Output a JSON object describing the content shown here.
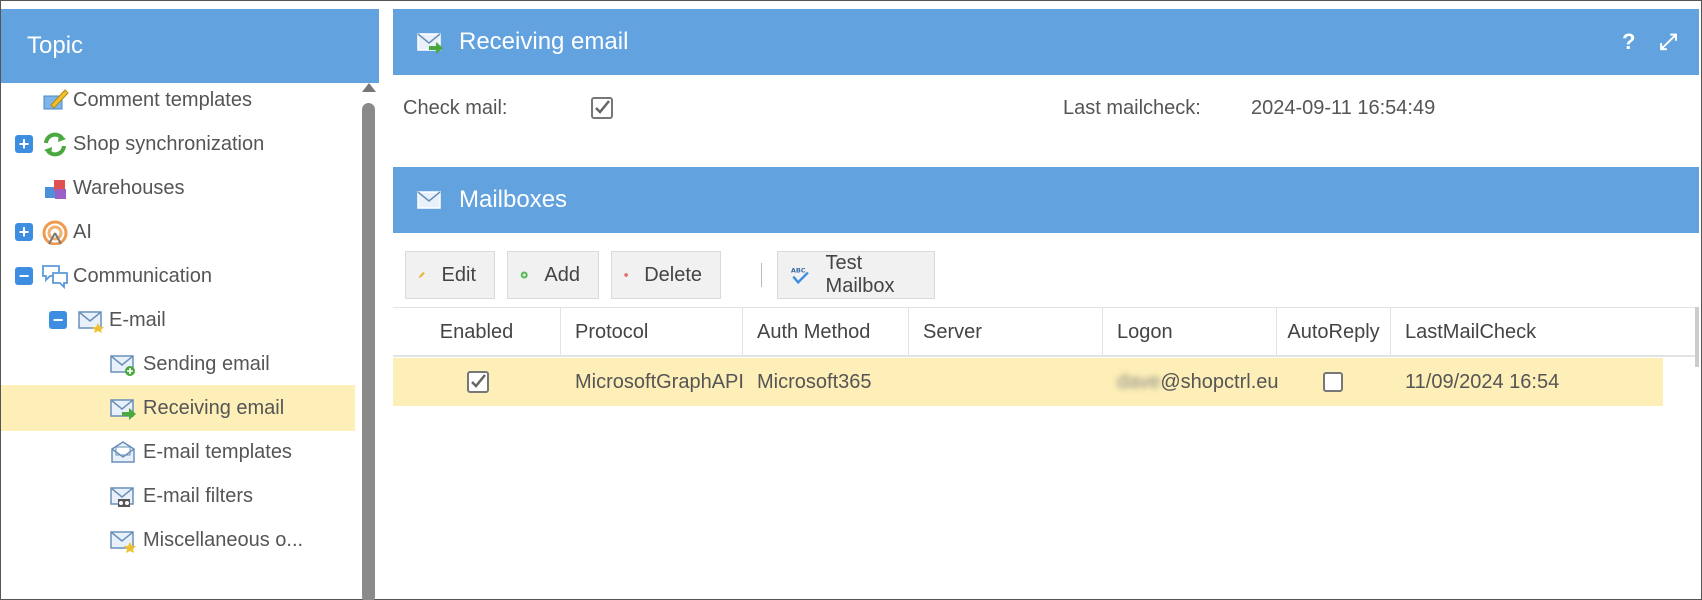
{
  "left_panel": {
    "title": "Topic",
    "items": [
      {
        "label": "Comment templates",
        "icon": "comment-template-icon",
        "expander": ""
      },
      {
        "label": "Shop synchronization",
        "icon": "sync-icon",
        "expander": "+"
      },
      {
        "label": "Warehouses",
        "icon": "warehouse-icon",
        "expander": ""
      },
      {
        "label": "AI",
        "icon": "ai-icon",
        "expander": "+"
      },
      {
        "label": "Communication",
        "icon": "communication-icon",
        "expander": "−"
      },
      {
        "label": "E-mail",
        "icon": "email-folder-icon",
        "expander": "−"
      },
      {
        "label": "Sending email",
        "icon": "send-email-icon",
        "expander": ""
      },
      {
        "label": "Receiving email",
        "icon": "receive-email-icon",
        "expander": ""
      },
      {
        "label": "E-mail templates",
        "icon": "email-template-icon",
        "expander": ""
      },
      {
        "label": "E-mail filters",
        "icon": "email-filter-icon",
        "expander": ""
      },
      {
        "label": "Miscellaneous o...",
        "icon": "email-misc-icon",
        "expander": ""
      }
    ]
  },
  "main": {
    "title": "Receiving email",
    "help_label": "?",
    "expand_label": "⤢",
    "check_mail_label": "Check mail:",
    "check_mail_checked": true,
    "last_mailcheck_label": "Last mailcheck:",
    "last_mailcheck_value": "2024-09-11 16:54:49",
    "mailboxes_title": "Mailboxes",
    "toolbar": {
      "edit": "Edit",
      "add": "Add",
      "delete": "Delete",
      "test": "Test Mailbox"
    },
    "columns": [
      "Enabled",
      "Protocol",
      "Auth Method",
      "Server",
      "Logon",
      "AutoReply",
      "LastMailCheck"
    ],
    "rows": [
      {
        "enabled": true,
        "protocol": "MicrosoftGraphAPI",
        "auth_method": "Microsoft365",
        "server": "",
        "logon_hidden": "dave",
        "logon_domain": "@shopctrl.eu",
        "autoreply": false,
        "last_mail_check": "11/09/2024 16:54"
      }
    ]
  },
  "colors": {
    "header_blue": "#62a2de",
    "selected_row": "#fdefb7",
    "expander_blue": "#3d8ee0"
  }
}
